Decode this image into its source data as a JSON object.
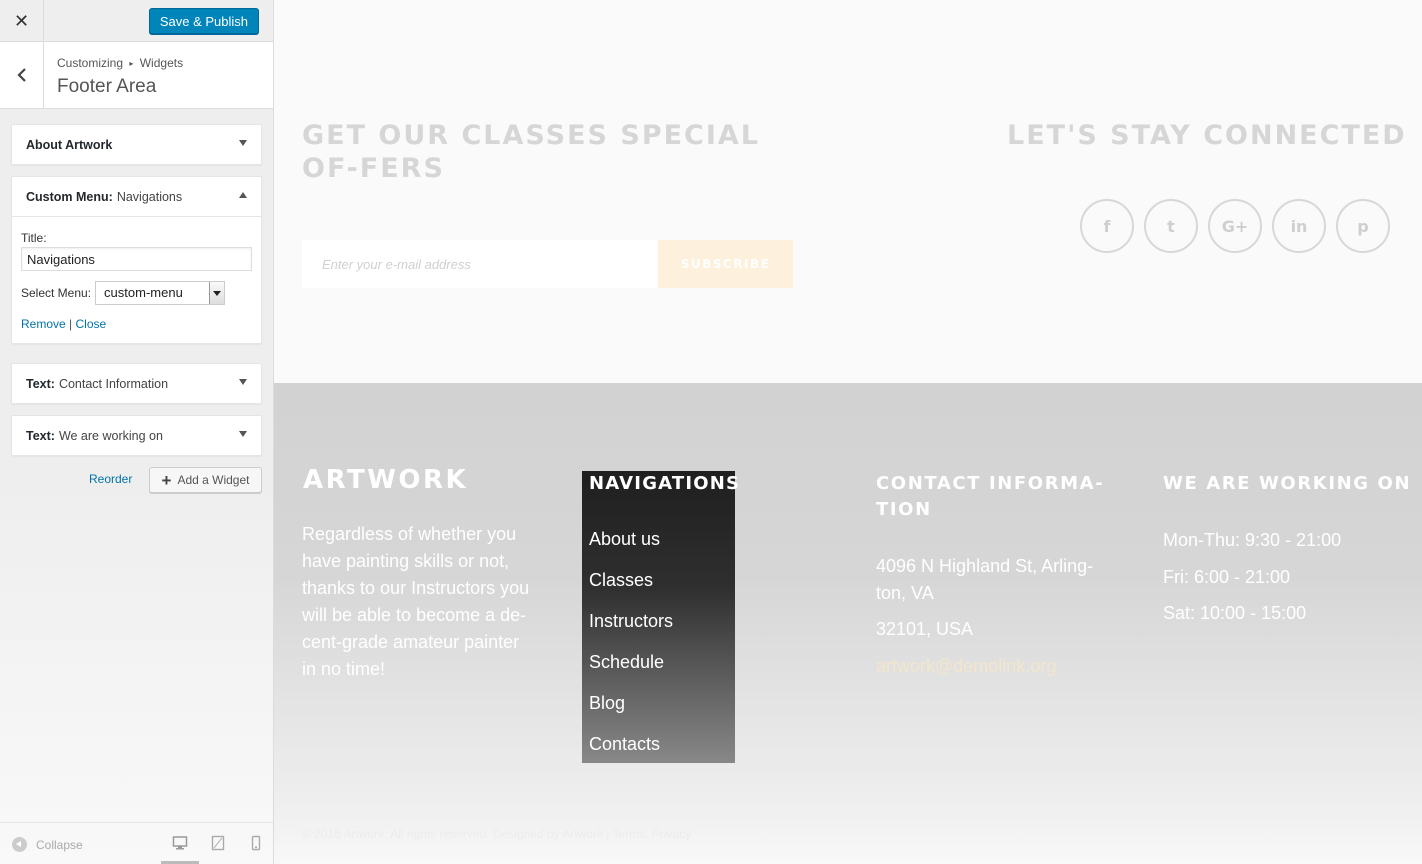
{
  "sidebar": {
    "close_icon": "close-icon",
    "save_label": "Save & Publish",
    "breadcrumb": {
      "parent": "Customizing",
      "child": "Widgets"
    },
    "section_title": "Footer Area",
    "widgets": [
      {
        "type": "About Artwork",
        "name": "",
        "expanded": false
      },
      {
        "type": "Custom Menu:",
        "name": "Navigations",
        "expanded": true
      },
      {
        "type": "Text:",
        "name": "Contact Information",
        "expanded": false
      },
      {
        "type": "Text:",
        "name": "We are working on",
        "expanded": false
      }
    ],
    "form": {
      "title_label": "Title:",
      "title_value": "Navigations",
      "select_label": "Select Menu:",
      "select_value": "custom-menu",
      "remove_label": "Remove",
      "separator": "|",
      "close_label": "Close"
    },
    "reorder_label": "Reorder",
    "add_widget_label": "Add a Widget",
    "collapse_label": "Collapse",
    "devices": [
      "desktop-icon",
      "tablet-icon",
      "mobile-icon"
    ],
    "active_device": "desktop"
  },
  "preview": {
    "offers_heading": "GET OUR CLASSES SPECIAL OF-FERS",
    "email_placeholder": "Enter your e-mail address",
    "subscribe_label": "SUBSCRIBE",
    "connected_heading": "LET'S STAY CONNECTED",
    "social": [
      {
        "icon": "facebook-icon",
        "glyph": "f"
      },
      {
        "icon": "twitter-icon",
        "glyph": "t"
      },
      {
        "icon": "google-plus-icon",
        "glyph": "G+"
      },
      {
        "icon": "linkedin-icon",
        "glyph": "in"
      },
      {
        "icon": "pinterest-icon",
        "glyph": "p"
      }
    ],
    "footer": {
      "artwork_heading": "ARTWORK",
      "about_text": "Regardless of whether you have painting skills or not, thanks to our Instructors you will be able to become a de-cent-grade amateur painter in no time!",
      "nav_heading": "NAVIGATIONS",
      "nav_items": [
        "About us",
        "Classes",
        "Instructors",
        "Schedule",
        "Blog",
        "Contacts"
      ],
      "contact_heading": "CONTACT INFORMA-TION",
      "address_line1": "4096 N Highland St, Arling-ton, VA",
      "address_line2": "32101, USA",
      "email": "artwork@demolink.org",
      "hours_heading": "WE ARE WORKING ON",
      "hours": [
        "Mon-Thu: 9:30 - 21:00",
        "Fri: 6:00 - 21:00",
        "Sat: 10:00 - 15:00"
      ],
      "copyright": "© 2016 Artwork. All rights reserved. Designed by Artwork  |  Terms. Privacy"
    }
  },
  "colors": {
    "primary_button": "#0085ba",
    "link": "#0073aa",
    "nav_block": "#1f1f1f",
    "subscribe_bg": "#fdf0dc"
  }
}
